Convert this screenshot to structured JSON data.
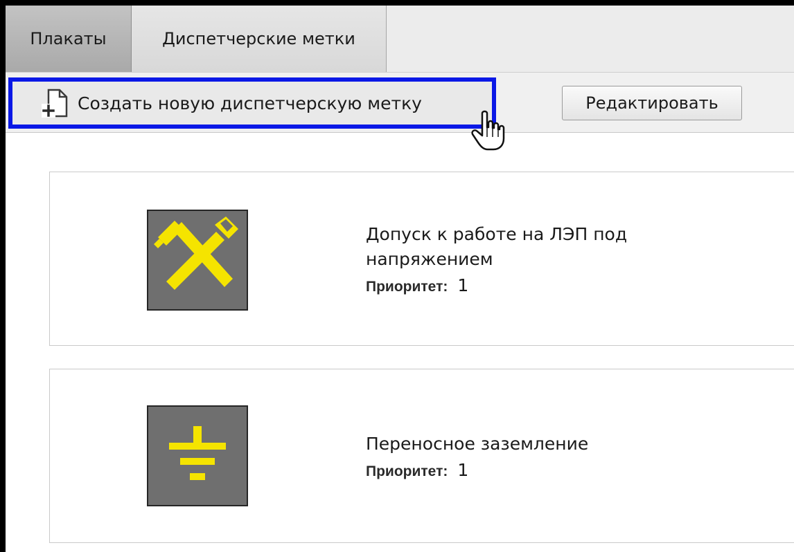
{
  "tabs": [
    {
      "label": "Плакаты"
    },
    {
      "label": "Диспетчерские метки"
    }
  ],
  "toolbar": {
    "create_label": "Создать новую диспетчерскую метку",
    "edit_label": "Редактировать"
  },
  "marks": [
    {
      "title": "Допуск к работе на ЛЭП под напряжением",
      "priority_label": "Приоритет:",
      "priority_value": "1",
      "icon": "crossed-tools-icon"
    },
    {
      "title": "Переносное заземление",
      "priority_label": "Приоритет:",
      "priority_value": "1",
      "icon": "grounding-icon"
    }
  ],
  "colors": {
    "highlight_border": "#0a18e6",
    "icon_background": "#6f6f6f",
    "icon_symbol": "#f5e400"
  },
  "icons": {
    "create": "new-document-plus-icon",
    "cursor": "hand-pointer-icon"
  }
}
